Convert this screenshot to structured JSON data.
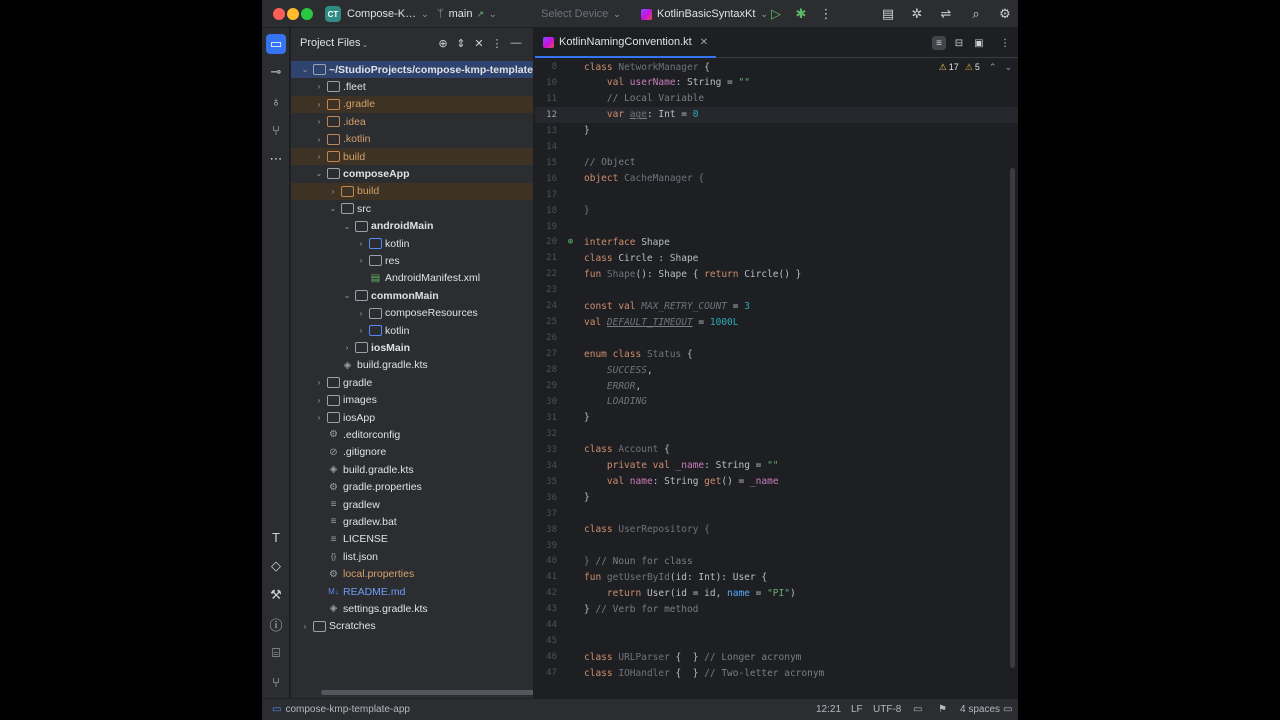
{
  "titlebar": {
    "project_badge": "CT",
    "project_name": "Compose-K…",
    "branch": "main",
    "device": "Select Device",
    "run_config": "KotlinBasicSyntaxKt"
  },
  "panel": {
    "title": "Project Files"
  },
  "tree": [
    {
      "label": "~/StudioProjects/compose-kmp-template-app",
      "depth": 0,
      "arrow": "down",
      "icon": "folder",
      "style": "bold",
      "row": "sel"
    },
    {
      "label": ".fleet",
      "depth": 1,
      "arrow": "right",
      "icon": "folder",
      "style": "",
      "row": ""
    },
    {
      "label": ".gradle",
      "depth": 1,
      "arrow": "right",
      "icon": "folder-orange",
      "style": "orange",
      "row": "ex"
    },
    {
      "label": ".idea",
      "depth": 1,
      "arrow": "right",
      "icon": "folder-orange",
      "style": "orange",
      "row": ""
    },
    {
      "label": ".kotlin",
      "depth": 1,
      "arrow": "right",
      "icon": "folder-orange",
      "style": "orange",
      "row": ""
    },
    {
      "label": "build",
      "depth": 1,
      "arrow": "right",
      "icon": "folder-orange",
      "style": "orange",
      "row": "ex"
    },
    {
      "label": "composeApp",
      "depth": 1,
      "arrow": "down",
      "icon": "folder",
      "style": "bold",
      "row": ""
    },
    {
      "label": "build",
      "depth": 2,
      "arrow": "right",
      "icon": "folder-orange",
      "style": "orange",
      "row": "ex"
    },
    {
      "label": "src",
      "depth": 2,
      "arrow": "down",
      "icon": "folder",
      "style": "",
      "row": ""
    },
    {
      "label": "androidMain",
      "depth": 3,
      "arrow": "down",
      "icon": "folder",
      "style": "bold",
      "row": ""
    },
    {
      "label": "kotlin",
      "depth": 4,
      "arrow": "right",
      "icon": "folder-blue",
      "style": "",
      "row": ""
    },
    {
      "label": "res",
      "depth": 4,
      "arrow": "right",
      "icon": "folder",
      "style": "",
      "row": ""
    },
    {
      "label": "AndroidManifest.xml",
      "depth": 4,
      "arrow": "",
      "icon": "file-green",
      "style": "",
      "row": ""
    },
    {
      "label": "commonMain",
      "depth": 3,
      "arrow": "down",
      "icon": "folder",
      "style": "bold",
      "row": ""
    },
    {
      "label": "composeResources",
      "depth": 4,
      "arrow": "right",
      "icon": "folder",
      "style": "",
      "row": ""
    },
    {
      "label": "kotlin",
      "depth": 4,
      "arrow": "right",
      "icon": "folder-blue",
      "style": "",
      "row": ""
    },
    {
      "label": "iosMain",
      "depth": 3,
      "arrow": "right",
      "icon": "folder",
      "style": "bold",
      "row": ""
    },
    {
      "label": "build.gradle.kts",
      "depth": 2,
      "arrow": "",
      "icon": "file-gradle",
      "style": "",
      "row": ""
    },
    {
      "label": "gradle",
      "depth": 1,
      "arrow": "right",
      "icon": "folder",
      "style": "",
      "row": ""
    },
    {
      "label": "images",
      "depth": 1,
      "arrow": "right",
      "icon": "folder",
      "style": "",
      "row": ""
    },
    {
      "label": "iosApp",
      "depth": 1,
      "arrow": "right",
      "icon": "folder",
      "style": "",
      "row": ""
    },
    {
      "label": ".editorconfig",
      "depth": 1,
      "arrow": "",
      "icon": "file-gear",
      "style": "",
      "row": ""
    },
    {
      "label": ".gitignore",
      "depth": 1,
      "arrow": "",
      "icon": "file-ignore",
      "style": "",
      "row": ""
    },
    {
      "label": "build.gradle.kts",
      "depth": 1,
      "arrow": "",
      "icon": "file-gradle",
      "style": "",
      "row": ""
    },
    {
      "label": "gradle.properties",
      "depth": 1,
      "arrow": "",
      "icon": "file-gear",
      "style": "",
      "row": ""
    },
    {
      "label": "gradlew",
      "depth": 1,
      "arrow": "",
      "icon": "file-text",
      "style": "",
      "row": ""
    },
    {
      "label": "gradlew.bat",
      "depth": 1,
      "arrow": "",
      "icon": "file-text",
      "style": "",
      "row": ""
    },
    {
      "label": "LICENSE",
      "depth": 1,
      "arrow": "",
      "icon": "file-text",
      "style": "",
      "row": ""
    },
    {
      "label": "list.json",
      "depth": 1,
      "arrow": "",
      "icon": "file-json",
      "style": "",
      "row": ""
    },
    {
      "label": "local.properties",
      "depth": 1,
      "arrow": "",
      "icon": "file-gear",
      "style": "orange",
      "row": ""
    },
    {
      "label": "README.md",
      "depth": 1,
      "arrow": "",
      "icon": "file-md",
      "style": "blue",
      "row": ""
    },
    {
      "label": "settings.gradle.kts",
      "depth": 1,
      "arrow": "",
      "icon": "file-gradle",
      "style": "",
      "row": ""
    },
    {
      "label": "Scratches",
      "depth": 0,
      "arrow": "right",
      "icon": "folder",
      "style": "",
      "row": ""
    }
  ],
  "editor": {
    "tab_label": "KotlinNamingConvention.kt",
    "warnings": "17",
    "weak_warnings": "5"
  },
  "code": [
    {
      "n": "8",
      "html": "<span class=\"kw\">class</span> <span class=\"dim\">NetworkManager</span> {",
      "cur": false,
      "gut": ""
    },
    {
      "n": "10",
      "html": "    <span class=\"kw\">val</span> <span class=\"pr\">userName</span>: String = <span class=\"st\">\"\"</span>",
      "cur": false,
      "gut": ""
    },
    {
      "n": "11",
      "html": "    <span class=\"cm\">// Local Variable</span>",
      "cur": false,
      "gut": ""
    },
    {
      "n": "12",
      "html": "    <span class=\"kw\">var</span> <span class=\"dim ul\">age</span>: Int = <span class=\"nm\">0</span>",
      "cur": true,
      "gut": ""
    },
    {
      "n": "13",
      "html": "}",
      "cur": false,
      "gut": ""
    },
    {
      "n": "14",
      "html": "",
      "cur": false,
      "gut": ""
    },
    {
      "n": "15",
      "html": "<span class=\"cm\">// Object</span>",
      "cur": false,
      "gut": ""
    },
    {
      "n": "16",
      "html": "<span class=\"kw\">object</span> <span class=\"dim\">CacheManager {</span>",
      "cur": false,
      "gut": ""
    },
    {
      "n": "17",
      "html": "",
      "cur": false,
      "gut": ""
    },
    {
      "n": "18",
      "html": "<span class=\"dim\">}</span>",
      "cur": false,
      "gut": ""
    },
    {
      "n": "19",
      "html": "",
      "cur": false,
      "gut": ""
    },
    {
      "n": "20",
      "html": "<span class=\"kw\">interface</span> Shape",
      "cur": false,
      "gut": "impl"
    },
    {
      "n": "21",
      "html": "<span class=\"kw\">class</span> Circle : Shape",
      "cur": false,
      "gut": ""
    },
    {
      "n": "22",
      "html": "<span class=\"kw\">fun</span> <span class=\"dim\">Shape</span>(): Shape { <span class=\"kw\">return</span> Circle() }",
      "cur": false,
      "gut": ""
    },
    {
      "n": "23",
      "html": "",
      "cur": false,
      "gut": ""
    },
    {
      "n": "24",
      "html": "<span class=\"kw\">const val</span> <span class=\"cst\" style=\"color:#6f737a\">MAX_RETRY_COUNT</span> = <span class=\"nm\">3</span>",
      "cur": false,
      "gut": ""
    },
    {
      "n": "25",
      "html": "<span class=\"kw\">val</span> <span class=\"cst ul\" style=\"color:#6f737a\">DEFAULT_TIMEOUT</span> = <span class=\"nm\">1000L</span>",
      "cur": false,
      "gut": ""
    },
    {
      "n": "26",
      "html": "",
      "cur": false,
      "gut": ""
    },
    {
      "n": "27",
      "html": "<span class=\"kw\">enum class</span> <span class=\"dim\">Status</span> {",
      "cur": false,
      "gut": ""
    },
    {
      "n": "28",
      "html": "    <span class=\"cst\" style=\"color:#6f737a\">SUCCESS</span>,",
      "cur": false,
      "gut": ""
    },
    {
      "n": "29",
      "html": "    <span class=\"cst\" style=\"color:#6f737a\">ERROR</span>,",
      "cur": false,
      "gut": ""
    },
    {
      "n": "30",
      "html": "    <span class=\"cst\" style=\"color:#6f737a\">LOADING</span>",
      "cur": false,
      "gut": ""
    },
    {
      "n": "31",
      "html": "}",
      "cur": false,
      "gut": ""
    },
    {
      "n": "32",
      "html": "",
      "cur": false,
      "gut": ""
    },
    {
      "n": "33",
      "html": "<span class=\"kw\">class</span> <span class=\"dim\">Account</span> {",
      "cur": false,
      "gut": ""
    },
    {
      "n": "34",
      "html": "    <span class=\"kw\">private val</span> <span class=\"pr\">_name</span>: String = <span class=\"st\">\"\"</span>",
      "cur": false,
      "gut": ""
    },
    {
      "n": "35",
      "html": "    <span class=\"kw\">val</span> <span class=\"pr\">name</span>: String <span class=\"kw\">get</span>() = <span class=\"pr\">_name</span>",
      "cur": false,
      "gut": ""
    },
    {
      "n": "36",
      "html": "}",
      "cur": false,
      "gut": ""
    },
    {
      "n": "37",
      "html": "",
      "cur": false,
      "gut": ""
    },
    {
      "n": "38",
      "html": "<span class=\"kw\">class</span> <span class=\"dim\">UserRepository {</span>",
      "cur": false,
      "gut": ""
    },
    {
      "n": "39",
      "html": "",
      "cur": false,
      "gut": ""
    },
    {
      "n": "40",
      "html": "<span class=\"dim\">}</span> <span class=\"cm\">// Noun for class</span>",
      "cur": false,
      "gut": ""
    },
    {
      "n": "41",
      "html": "<span class=\"kw\">fun</span> <span class=\"dim\">getUserById</span>(id: Int): User {",
      "cur": false,
      "gut": ""
    },
    {
      "n": "42",
      "html": "    <span class=\"kw\">return</span> User(id = id, <span class=\"fn\">name</span> = <span class=\"st\">\"PI\"</span>)",
      "cur": false,
      "gut": ""
    },
    {
      "n": "43",
      "html": "} <span class=\"cm\">// Verb for method</span>",
      "cur": false,
      "gut": ""
    },
    {
      "n": "44",
      "html": "",
      "cur": false,
      "gut": ""
    },
    {
      "n": "45",
      "html": "",
      "cur": false,
      "gut": ""
    },
    {
      "n": "46",
      "html": "<span class=\"kw\">class</span> <span class=\"dim\">URLParser</span> {  } <span class=\"cm\">// Longer acronym</span>",
      "cur": false,
      "gut": ""
    },
    {
      "n": "47",
      "html": "<span class=\"kw\">class</span> <span class=\"dim\">IOHandler</span> {  } <span class=\"cm\">// Two-letter acronym</span>",
      "cur": false,
      "gut": ""
    }
  ],
  "status": {
    "breadcrumb": "compose-kmp-template-app",
    "position": "12:21",
    "line_sep": "LF",
    "encoding": "UTF-8",
    "indent": "4 spaces"
  }
}
